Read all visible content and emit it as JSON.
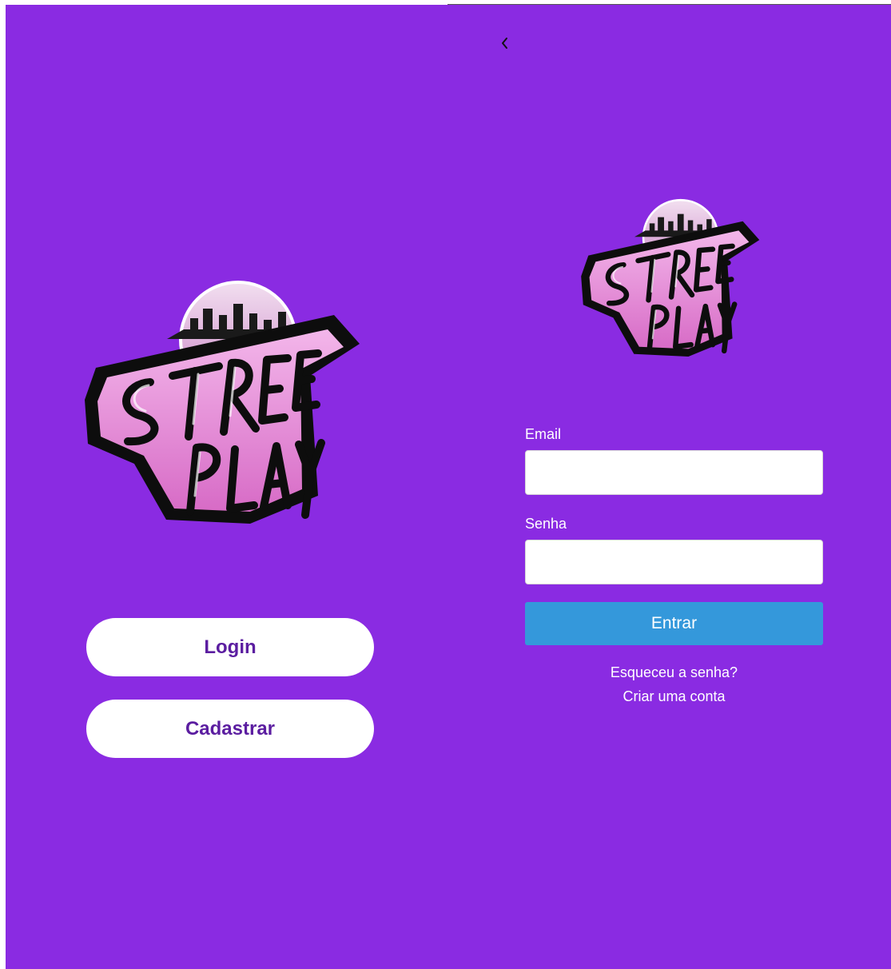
{
  "colors": {
    "panel_background": "#8a2be2",
    "primary_button": "#3498db",
    "pill_button_text": "#5b1da0",
    "logo_pink": "#e68fd6",
    "logo_outline": "#111111"
  },
  "icons": {
    "back": "chevron-left-icon",
    "logo": "street-play-logo"
  },
  "welcome": {
    "login_label": "Login",
    "signup_label": "Cadastrar"
  },
  "login_form": {
    "email_label": "Email",
    "email_value": "",
    "password_label": "Senha",
    "password_value": "",
    "submit_label": "Entrar",
    "forgot_password": "Esqueceu a senha?",
    "create_account": "Criar uma conta"
  }
}
